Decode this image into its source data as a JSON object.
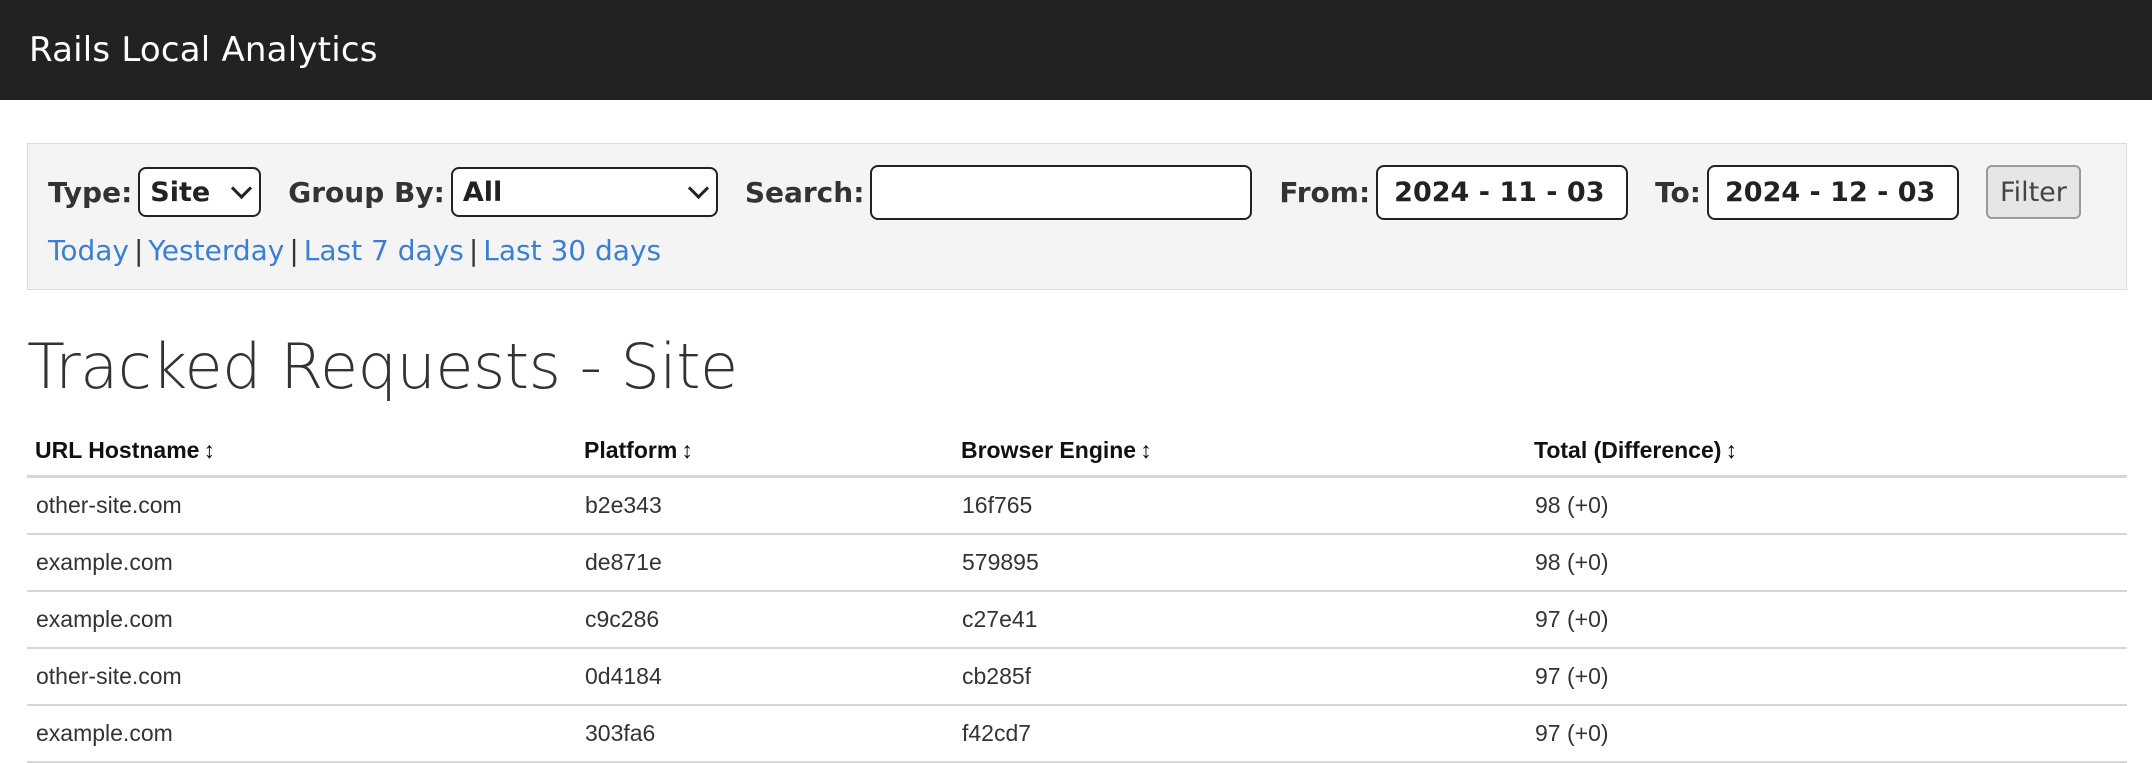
{
  "app": {
    "title": "Rails Local Analytics"
  },
  "filters": {
    "type_label": "Type:",
    "type_value": "Site",
    "group_by_label": "Group By:",
    "group_by_value": "All",
    "search_label": "Search:",
    "search_value": "",
    "from_label": "From:",
    "from_value": "2024 - 11 - 03",
    "to_label": "To:",
    "to_value": "2024 - 12 - 03",
    "filter_button": "Filter",
    "calendar_icon": "calendar-icon"
  },
  "quick_ranges": {
    "today": "Today",
    "yesterday": "Yesterday",
    "last_7": "Last 7 days",
    "last_30": "Last 30 days",
    "separator": "|"
  },
  "page_title": "Tracked Requests - Site",
  "table": {
    "sort_glyph": "↕",
    "columns": [
      "URL Hostname",
      "Platform",
      "Browser Engine",
      "Total (Difference)"
    ],
    "rows": [
      [
        "other-site.com",
        "b2e343",
        "16f765",
        "98 (+0)"
      ],
      [
        "example.com",
        "de871e",
        "579895",
        "98 (+0)"
      ],
      [
        "example.com",
        "c9c286",
        "c27e41",
        "97 (+0)"
      ],
      [
        "other-site.com",
        "0d4184",
        "cb285f",
        "97 (+0)"
      ],
      [
        "example.com",
        "303fa6",
        "f42cd7",
        "97 (+0)"
      ]
    ]
  },
  "colors": {
    "navbar": "#222222",
    "link": "#3a7fd4",
    "panel": "#f4f4f4"
  }
}
